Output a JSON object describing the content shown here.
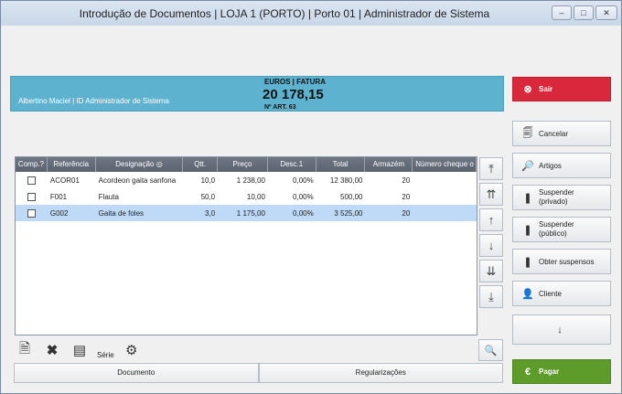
{
  "window": {
    "title": "Introdução de Documentos | LOJA 1 (PORTO) | Porto 01 | Administrador de Sistema",
    "controls": [
      "minimize-icon",
      "maximize-icon",
      "close-icon"
    ]
  },
  "banner": {
    "user": "Albertino Maciel | ID Administrador de Sistema",
    "currency": "EUROS | FATURA",
    "total": "20 178,15",
    "articles": "Nº ART. 63",
    "color": "#5db3cf"
  },
  "grid": {
    "columns": [
      "Comp.?",
      "Referência",
      "Designação",
      "Qtt.",
      "Preço",
      "Desc.1",
      "Total",
      "Armazém",
      "Número cheque o"
    ],
    "rows": [
      {
        "ref": "ACOR01",
        "desc": "Acordeon gaita sanfona",
        "qty": "10,0",
        "price": "1 238,00",
        "disc": "0,00%",
        "total": "12 380,00",
        "wh": "20",
        "selected": false
      },
      {
        "ref": "F001",
        "desc": "Flauta",
        "qty": "50,0",
        "price": "10,00",
        "disc": "0,00%",
        "total": "500,00",
        "wh": "20",
        "selected": false
      },
      {
        "ref": "G002",
        "desc": "Gaita de foles",
        "qty": "3,0",
        "price": "1 175,00",
        "disc": "0,00%",
        "total": "3 525,00",
        "wh": "20",
        "selected": true
      }
    ]
  },
  "toolbar": {
    "serie_label": "Série"
  },
  "tabs": {
    "document": "Documento",
    "settlements": "Regularizações"
  },
  "side": {
    "exit": "Sair",
    "cancel": "Cancelar",
    "articles": "Artigos",
    "suspend_private": "Suspender (privado)",
    "suspend_public": "Suspender (público)",
    "get_suspended": "Obter suspensos",
    "client": "Cliente",
    "pay": "Pagar"
  },
  "colors": {
    "exit": "#d9283b",
    "pay": "#5d9b2a",
    "selected_row": "#bfdaf6"
  }
}
